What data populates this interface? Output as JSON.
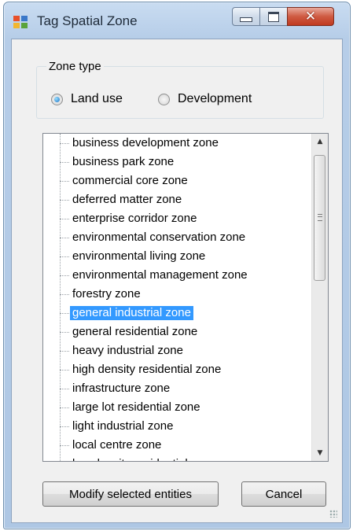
{
  "window": {
    "title": "Tag Spatial Zone"
  },
  "zone_type": {
    "label": "Zone type",
    "options": [
      {
        "label": "Land use",
        "selected": true
      },
      {
        "label": "Development",
        "selected": false
      }
    ]
  },
  "zone_list": {
    "selected": "general industrial zone",
    "items": [
      "business development zone",
      "business park zone",
      "commercial core zone",
      "deferred matter zone",
      "enterprise corridor zone",
      "environmental conservation zone",
      "environmental living zone",
      "environmental management zone",
      "forestry zone",
      "general industrial zone",
      "general residential zone",
      "heavy industrial zone",
      "high density residential zone",
      "infrastructure zone",
      "large lot residential zone",
      "light industrial zone",
      "local centre zone",
      "low density residential zone"
    ]
  },
  "buttons": {
    "modify": "Modify selected entities",
    "cancel": "Cancel"
  },
  "colors": {
    "selection": "#3399ff",
    "close_button": "#c9452b"
  }
}
